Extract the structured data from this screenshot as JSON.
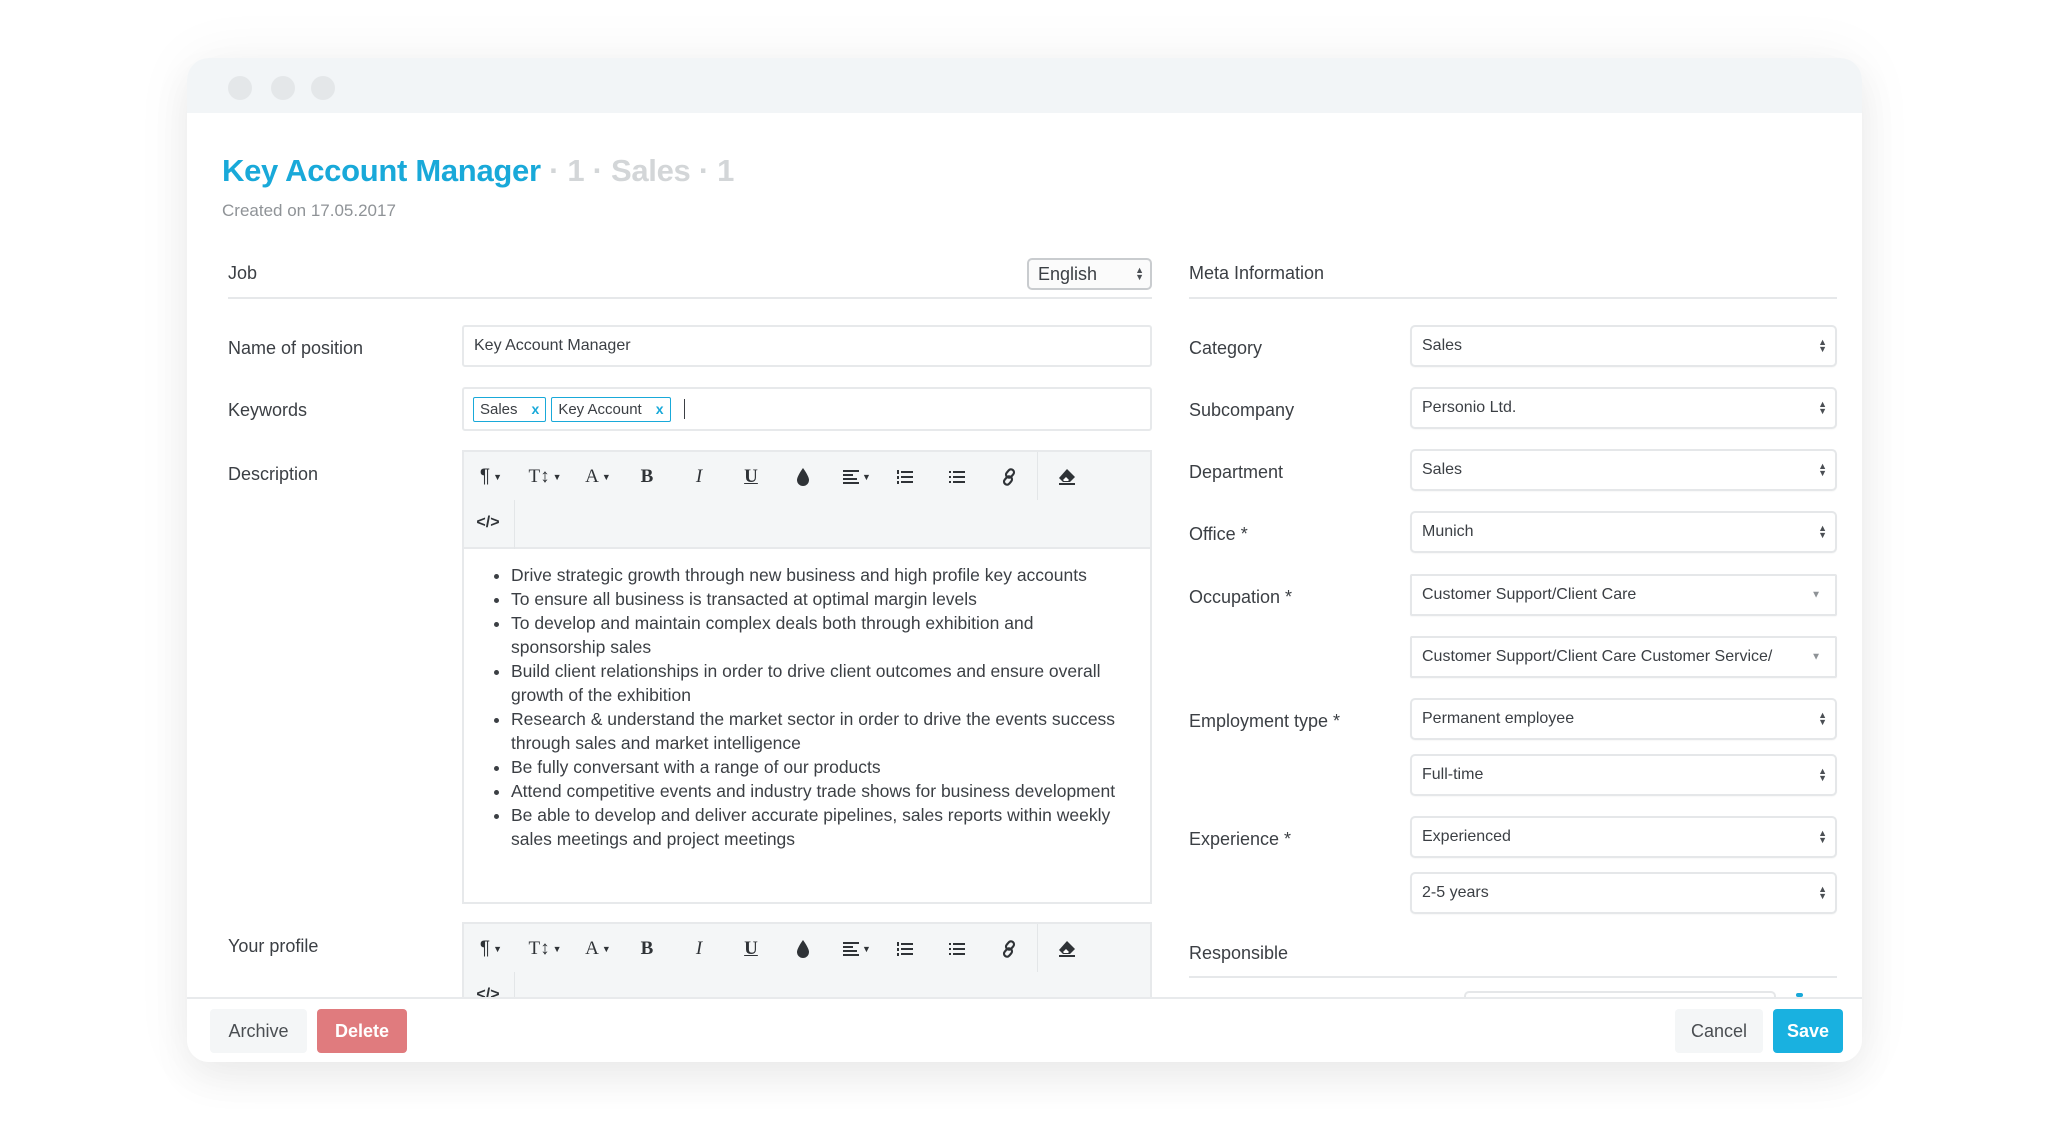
{
  "window": {
    "title": "Key Account Manager",
    "title_meta": "· 1 · Sales · 1",
    "created": "Created on 17.05.2017"
  },
  "job": {
    "section_title": "Job",
    "language": "English",
    "fields": {
      "name_of_position": {
        "label": "Name of position",
        "value": "Key Account Manager"
      },
      "keywords": {
        "label": "Keywords",
        "tags": [
          "Sales",
          "Key Account"
        ],
        "remove_glyph": "x"
      },
      "description": {
        "label": "Description",
        "bullets": [
          "Drive strategic growth through new business and high profile key accounts",
          "To ensure all business is transacted at optimal margin levels",
          "To develop and maintain complex deals both through exhibition and sponsorship sales",
          "Build client relationships in order to drive client outcomes and ensure overall growth of the exhibition",
          "Research & understand the market sector in order to drive the events success through sales and market intelligence",
          "Be fully conversant with a range of our products",
          "Attend competitive events and industry trade shows for business development",
          "Be able to develop and deliver accurate pipelines, sales reports within weekly sales meetings and project meetings"
        ]
      },
      "your_profile": {
        "label": "Your profile"
      }
    }
  },
  "toolbar": {
    "icons": [
      "paragraph-icon",
      "text-height-icon",
      "font-color-icon",
      "bold-icon",
      "italic-icon",
      "underline-icon",
      "color-drop-icon",
      "align-icon",
      "ordered-list-icon",
      "unordered-list-icon",
      "link-icon",
      "eraser-icon",
      "code-view-icon"
    ],
    "glyphs": {
      "paragraph": "¶",
      "text_height": "T↕",
      "font": "A",
      "bold": "B",
      "italic": "I",
      "underline": "U",
      "drop": "💧",
      "align": "☰",
      "ordered_list": "1≡",
      "unordered_list": "⁝≡",
      "link": "🔗",
      "eraser": "⌫",
      "code": "</>",
      "dropdown": "▼"
    }
  },
  "meta": {
    "section_title": "Meta Information",
    "category": {
      "label": "Category",
      "value": "Sales"
    },
    "subcompany": {
      "label": "Subcompany",
      "value": "Personio Ltd."
    },
    "department": {
      "label": "Department",
      "value": "Sales"
    },
    "office": {
      "label": "Office *",
      "value": "Munich"
    },
    "occupation": {
      "label": "Occupation *",
      "value": "Customer Support/Client Care",
      "sub_value": "Customer Support/Client Care Customer Service/"
    },
    "employment_type": {
      "label": "Employment type *",
      "value": "Permanent employee",
      "sub_value": "Full-time"
    },
    "experience": {
      "label": "Experience *",
      "value": "Experienced",
      "sub_value": "2-5 years"
    },
    "responsible": {
      "label": "Responsible"
    }
  },
  "footer": {
    "archive": "Archive",
    "delete": "Delete",
    "cancel": "Cancel",
    "save": "Save"
  },
  "colors": {
    "accent": "#19a9d9",
    "save": "#19b1e0",
    "delete": "#e07b7e",
    "titlebar": "#f2f5f7"
  }
}
